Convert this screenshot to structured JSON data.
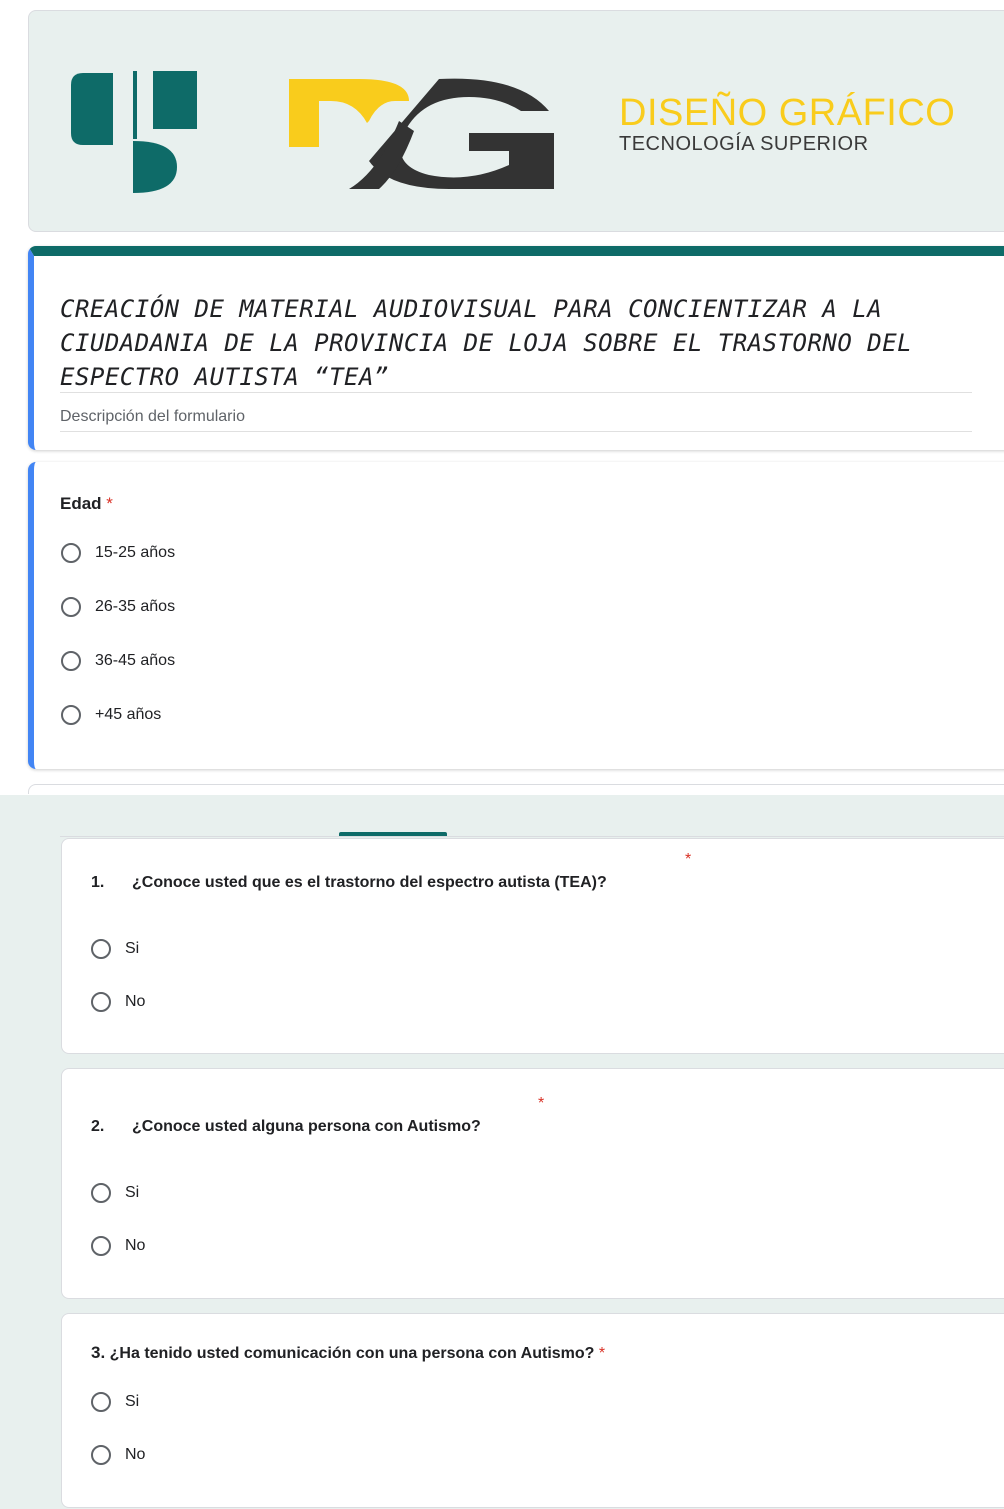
{
  "header": {
    "brand_title": "DISEÑO GRÁFICO",
    "brand_subtitle": "TECNOLOGÍA SUPERIOR",
    "logo_letters": "DG"
  },
  "form": {
    "title": "CREACIÓN DE MATERIAL AUDIOVISUAL PARA CONCIENTIZAR A LA CIUDADANIA DE LA PROVINCIA DE LOJA SOBRE EL TRASTORNO DEL ESPECTRO AUTISTA “TEA”",
    "description_placeholder": "Descripción del formulario"
  },
  "edad": {
    "label": "Edad",
    "required_mark": "*",
    "options": [
      "15-25 años",
      "26-35 años",
      "36-45 años",
      "+45 años"
    ]
  },
  "questions": [
    {
      "number": "1.",
      "text": "¿Conoce usted que es el trastorno del espectro autista (TEA)?",
      "required_mark": "*",
      "options": [
        "Si",
        "No"
      ]
    },
    {
      "number": "2.",
      "text": "¿Conoce usted alguna persona con Autismo?",
      "required_mark": "*",
      "options": [
        "Si",
        "No"
      ]
    },
    {
      "number": "3.",
      "text": "¿Ha tenido usted comunicación con una persona con Autismo?",
      "required_mark": "*",
      "options": [
        "Si",
        "No"
      ]
    }
  ],
  "colors": {
    "teal": "#0e6b68",
    "yellow": "#f9cc1c",
    "dark": "#333333",
    "accent_blue": "#4285f4",
    "required_red": "#d93025"
  }
}
